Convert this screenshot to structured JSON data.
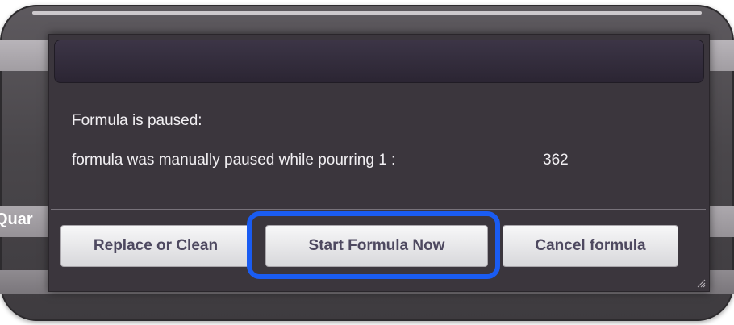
{
  "background": {
    "partial_label": "Quar"
  },
  "dialog": {
    "title": "",
    "message_line1": "Formula is paused:",
    "message_line2": "formula was manually paused while pourring 1 :",
    "message_value": "362",
    "buttons": {
      "replace_label": "Replace or Clean",
      "start_label": "Start Formula Now",
      "cancel_label": "Cancel formula"
    },
    "highlight_color": "#1a5cf2"
  },
  "icons": {
    "resize_grip": "resize-grip-icon"
  }
}
